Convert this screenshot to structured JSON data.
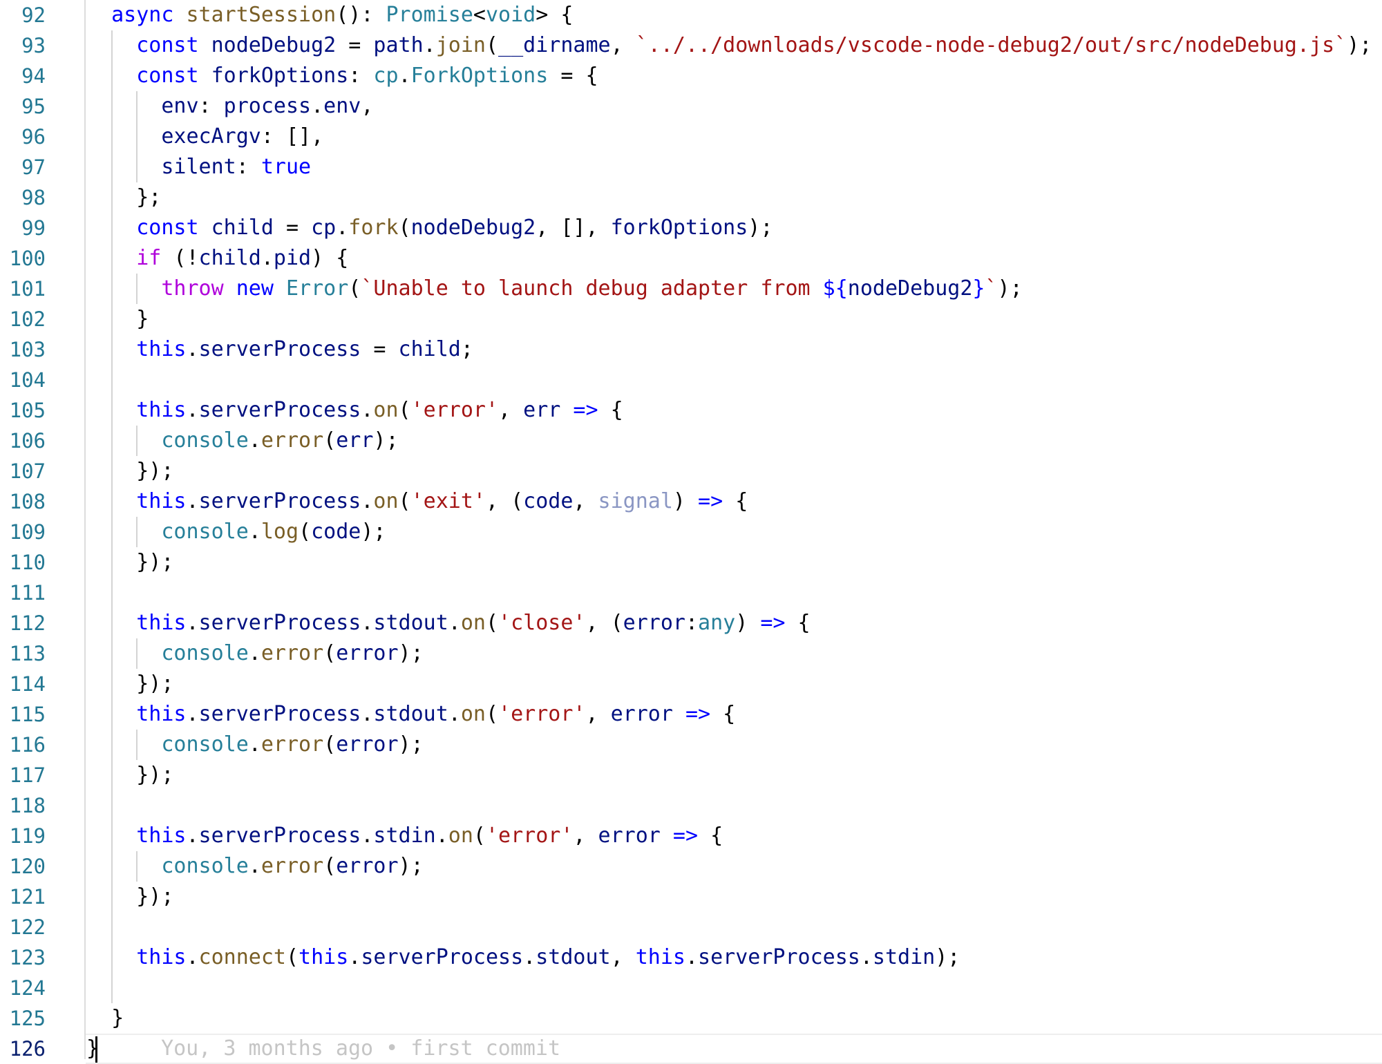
{
  "editor": {
    "active_line": 126,
    "blame_annotation": "You, 3 months ago • first commit",
    "colors": {
      "keyword": "#0000ff",
      "control_keyword": "#af00db",
      "function": "#795e26",
      "type": "#267f99",
      "variable": "#001080",
      "string": "#a31515",
      "unused_parameter": "#8a96c3",
      "line_number": "#237893",
      "active_line_number": "#0b216f"
    },
    "lines": [
      {
        "n": "92",
        "indent": 1,
        "guides": [],
        "tokens": [
          [
            "kw",
            "async"
          ],
          [
            "pn",
            " "
          ],
          [
            "fn",
            "startSession"
          ],
          [
            "pn",
            "(): "
          ],
          [
            "ty",
            "Promise"
          ],
          [
            "pn",
            "<"
          ],
          [
            "ty",
            "void"
          ],
          [
            "pn",
            "> {"
          ]
        ]
      },
      {
        "n": "93",
        "indent": 2,
        "guides": [
          1
        ],
        "tokens": [
          [
            "kw",
            "const"
          ],
          [
            "pn",
            " "
          ],
          [
            "vr",
            "nodeDebug2"
          ],
          [
            "pn",
            " = "
          ],
          [
            "vr",
            "path"
          ],
          [
            "pn",
            "."
          ],
          [
            "fn",
            "join"
          ],
          [
            "pn",
            "("
          ],
          [
            "vr",
            "__dirname"
          ],
          [
            "pn",
            ", "
          ],
          [
            "st",
            "`../../downloads/vscode-node-debug2/out/src/nodeDebug.js`"
          ],
          [
            "pn",
            ");"
          ]
        ]
      },
      {
        "n": "94",
        "indent": 2,
        "guides": [
          1
        ],
        "tokens": [
          [
            "kw",
            "const"
          ],
          [
            "pn",
            " "
          ],
          [
            "vr",
            "forkOptions"
          ],
          [
            "pn",
            ": "
          ],
          [
            "ty",
            "cp"
          ],
          [
            "pn",
            "."
          ],
          [
            "ty",
            "ForkOptions"
          ],
          [
            "pn",
            " = {"
          ]
        ]
      },
      {
        "n": "95",
        "indent": 3,
        "guides": [
          1,
          2
        ],
        "tokens": [
          [
            "vr",
            "env"
          ],
          [
            "pn",
            ": "
          ],
          [
            "vr",
            "process"
          ],
          [
            "pn",
            "."
          ],
          [
            "vr",
            "env"
          ],
          [
            "pn",
            ","
          ]
        ]
      },
      {
        "n": "96",
        "indent": 3,
        "guides": [
          1,
          2
        ],
        "tokens": [
          [
            "vr",
            "execArgv"
          ],
          [
            "pn",
            ": [],"
          ]
        ]
      },
      {
        "n": "97",
        "indent": 3,
        "guides": [
          1,
          2
        ],
        "tokens": [
          [
            "vr",
            "silent"
          ],
          [
            "pn",
            ": "
          ],
          [
            "kw",
            "true"
          ]
        ]
      },
      {
        "n": "98",
        "indent": 2,
        "guides": [
          1
        ],
        "tokens": [
          [
            "pn",
            "};"
          ]
        ]
      },
      {
        "n": "99",
        "indent": 2,
        "guides": [
          1
        ],
        "tokens": [
          [
            "kw",
            "const"
          ],
          [
            "pn",
            " "
          ],
          [
            "vr",
            "child"
          ],
          [
            "pn",
            " = "
          ],
          [
            "vr",
            "cp"
          ],
          [
            "pn",
            "."
          ],
          [
            "fn",
            "fork"
          ],
          [
            "pn",
            "("
          ],
          [
            "vr",
            "nodeDebug2"
          ],
          [
            "pn",
            ", [], "
          ],
          [
            "vr",
            "forkOptions"
          ],
          [
            "pn",
            ");"
          ]
        ]
      },
      {
        "n": "100",
        "indent": 2,
        "guides": [
          1
        ],
        "tokens": [
          [
            "kwc",
            "if"
          ],
          [
            "pn",
            " (!"
          ],
          [
            "vr",
            "child"
          ],
          [
            "pn",
            "."
          ],
          [
            "vr",
            "pid"
          ],
          [
            "pn",
            ") {"
          ]
        ]
      },
      {
        "n": "101",
        "indent": 3,
        "guides": [
          1,
          2
        ],
        "tokens": [
          [
            "kwc",
            "throw"
          ],
          [
            "pn",
            " "
          ],
          [
            "kw",
            "new"
          ],
          [
            "pn",
            " "
          ],
          [
            "ty",
            "Error"
          ],
          [
            "pn",
            "("
          ],
          [
            "st",
            "`Unable to launch debug adapter from "
          ],
          [
            "kw",
            "${"
          ],
          [
            "vr",
            "nodeDebug2"
          ],
          [
            "kw",
            "}"
          ],
          [
            "st",
            "`"
          ],
          [
            "pn",
            ");"
          ]
        ]
      },
      {
        "n": "102",
        "indent": 2,
        "guides": [
          1
        ],
        "tokens": [
          [
            "pn",
            "}"
          ]
        ]
      },
      {
        "n": "103",
        "indent": 2,
        "guides": [
          1
        ],
        "tokens": [
          [
            "kw",
            "this"
          ],
          [
            "pn",
            "."
          ],
          [
            "vr",
            "serverProcess"
          ],
          [
            "pn",
            " = "
          ],
          [
            "vr",
            "child"
          ],
          [
            "pn",
            ";"
          ]
        ]
      },
      {
        "n": "104",
        "indent": 2,
        "guides": [
          1
        ],
        "tokens": []
      },
      {
        "n": "105",
        "indent": 2,
        "guides": [
          1
        ],
        "tokens": [
          [
            "kw",
            "this"
          ],
          [
            "pn",
            "."
          ],
          [
            "vr",
            "serverProcess"
          ],
          [
            "pn",
            "."
          ],
          [
            "fn",
            "on"
          ],
          [
            "pn",
            "("
          ],
          [
            "st",
            "'error'"
          ],
          [
            "pn",
            ", "
          ],
          [
            "vr",
            "err"
          ],
          [
            "pn",
            " "
          ],
          [
            "kw",
            "=>"
          ],
          [
            "pn",
            " {"
          ]
        ]
      },
      {
        "n": "106",
        "indent": 3,
        "guides": [
          1,
          2
        ],
        "tokens": [
          [
            "ty",
            "console"
          ],
          [
            "pn",
            "."
          ],
          [
            "fn",
            "error"
          ],
          [
            "pn",
            "("
          ],
          [
            "vr",
            "err"
          ],
          [
            "pn",
            ");"
          ]
        ]
      },
      {
        "n": "107",
        "indent": 2,
        "guides": [
          1
        ],
        "tokens": [
          [
            "pn",
            "});"
          ]
        ]
      },
      {
        "n": "108",
        "indent": 2,
        "guides": [
          1
        ],
        "tokens": [
          [
            "kw",
            "this"
          ],
          [
            "pn",
            "."
          ],
          [
            "vr",
            "serverProcess"
          ],
          [
            "pn",
            "."
          ],
          [
            "fn",
            "on"
          ],
          [
            "pn",
            "("
          ],
          [
            "st",
            "'exit'"
          ],
          [
            "pn",
            ", ("
          ],
          [
            "vr",
            "code"
          ],
          [
            "pn",
            ", "
          ],
          [
            "unused",
            "signal"
          ],
          [
            "pn",
            ") "
          ],
          [
            "kw",
            "=>"
          ],
          [
            "pn",
            " {"
          ]
        ]
      },
      {
        "n": "109",
        "indent": 3,
        "guides": [
          1,
          2
        ],
        "tokens": [
          [
            "ty",
            "console"
          ],
          [
            "pn",
            "."
          ],
          [
            "fn",
            "log"
          ],
          [
            "pn",
            "("
          ],
          [
            "vr",
            "code"
          ],
          [
            "pn",
            ");"
          ]
        ]
      },
      {
        "n": "110",
        "indent": 2,
        "guides": [
          1
        ],
        "tokens": [
          [
            "pn",
            "});"
          ]
        ]
      },
      {
        "n": "111",
        "indent": 2,
        "guides": [
          1
        ],
        "tokens": []
      },
      {
        "n": "112",
        "indent": 2,
        "guides": [
          1
        ],
        "tokens": [
          [
            "kw",
            "this"
          ],
          [
            "pn",
            "."
          ],
          [
            "vr",
            "serverProcess"
          ],
          [
            "pn",
            "."
          ],
          [
            "vr",
            "stdout"
          ],
          [
            "pn",
            "."
          ],
          [
            "fn",
            "on"
          ],
          [
            "pn",
            "("
          ],
          [
            "st",
            "'close'"
          ],
          [
            "pn",
            ", ("
          ],
          [
            "vr",
            "error"
          ],
          [
            "pn",
            ":"
          ],
          [
            "ty",
            "any"
          ],
          [
            "pn",
            ") "
          ],
          [
            "kw",
            "=>"
          ],
          [
            "pn",
            " {"
          ]
        ]
      },
      {
        "n": "113",
        "indent": 3,
        "guides": [
          1,
          2
        ],
        "tokens": [
          [
            "ty",
            "console"
          ],
          [
            "pn",
            "."
          ],
          [
            "fn",
            "error"
          ],
          [
            "pn",
            "("
          ],
          [
            "vr",
            "error"
          ],
          [
            "pn",
            ");"
          ]
        ]
      },
      {
        "n": "114",
        "indent": 2,
        "guides": [
          1
        ],
        "tokens": [
          [
            "pn",
            "});"
          ]
        ]
      },
      {
        "n": "115",
        "indent": 2,
        "guides": [
          1
        ],
        "tokens": [
          [
            "kw",
            "this"
          ],
          [
            "pn",
            "."
          ],
          [
            "vr",
            "serverProcess"
          ],
          [
            "pn",
            "."
          ],
          [
            "vr",
            "stdout"
          ],
          [
            "pn",
            "."
          ],
          [
            "fn",
            "on"
          ],
          [
            "pn",
            "("
          ],
          [
            "st",
            "'error'"
          ],
          [
            "pn",
            ", "
          ],
          [
            "vr",
            "error"
          ],
          [
            "pn",
            " "
          ],
          [
            "kw",
            "=>"
          ],
          [
            "pn",
            " {"
          ]
        ]
      },
      {
        "n": "116",
        "indent": 3,
        "guides": [
          1,
          2
        ],
        "tokens": [
          [
            "ty",
            "console"
          ],
          [
            "pn",
            "."
          ],
          [
            "fn",
            "error"
          ],
          [
            "pn",
            "("
          ],
          [
            "vr",
            "error"
          ],
          [
            "pn",
            ");"
          ]
        ]
      },
      {
        "n": "117",
        "indent": 2,
        "guides": [
          1
        ],
        "tokens": [
          [
            "pn",
            "});"
          ]
        ]
      },
      {
        "n": "118",
        "indent": 2,
        "guides": [
          1
        ],
        "tokens": []
      },
      {
        "n": "119",
        "indent": 2,
        "guides": [
          1
        ],
        "tokens": [
          [
            "kw",
            "this"
          ],
          [
            "pn",
            "."
          ],
          [
            "vr",
            "serverProcess"
          ],
          [
            "pn",
            "."
          ],
          [
            "vr",
            "stdin"
          ],
          [
            "pn",
            "."
          ],
          [
            "fn",
            "on"
          ],
          [
            "pn",
            "("
          ],
          [
            "st",
            "'error'"
          ],
          [
            "pn",
            ", "
          ],
          [
            "vr",
            "error"
          ],
          [
            "pn",
            " "
          ],
          [
            "kw",
            "=>"
          ],
          [
            "pn",
            " {"
          ]
        ]
      },
      {
        "n": "120",
        "indent": 3,
        "guides": [
          1,
          2
        ],
        "tokens": [
          [
            "ty",
            "console"
          ],
          [
            "pn",
            "."
          ],
          [
            "fn",
            "error"
          ],
          [
            "pn",
            "("
          ],
          [
            "vr",
            "error"
          ],
          [
            "pn",
            ");"
          ]
        ]
      },
      {
        "n": "121",
        "indent": 2,
        "guides": [
          1
        ],
        "tokens": [
          [
            "pn",
            "});"
          ]
        ]
      },
      {
        "n": "122",
        "indent": 2,
        "guides": [
          1
        ],
        "tokens": []
      },
      {
        "n": "123",
        "indent": 2,
        "guides": [
          1
        ],
        "tokens": [
          [
            "kw",
            "this"
          ],
          [
            "pn",
            "."
          ],
          [
            "fn",
            "connect"
          ],
          [
            "pn",
            "("
          ],
          [
            "kw",
            "this"
          ],
          [
            "pn",
            "."
          ],
          [
            "vr",
            "serverProcess"
          ],
          [
            "pn",
            "."
          ],
          [
            "vr",
            "stdout"
          ],
          [
            "pn",
            ", "
          ],
          [
            "kw",
            "this"
          ],
          [
            "pn",
            "."
          ],
          [
            "vr",
            "serverProcess"
          ],
          [
            "pn",
            "."
          ],
          [
            "vr",
            "stdin"
          ],
          [
            "pn",
            ");"
          ]
        ]
      },
      {
        "n": "124",
        "indent": 2,
        "guides": [
          1
        ],
        "tokens": []
      },
      {
        "n": "125",
        "indent": 1,
        "guides": [],
        "tokens": [
          [
            "pn",
            "}"
          ]
        ]
      },
      {
        "n": "126",
        "indent": 0,
        "guides": [],
        "tokens": [
          [
            "pn",
            "}"
          ]
        ]
      }
    ]
  }
}
